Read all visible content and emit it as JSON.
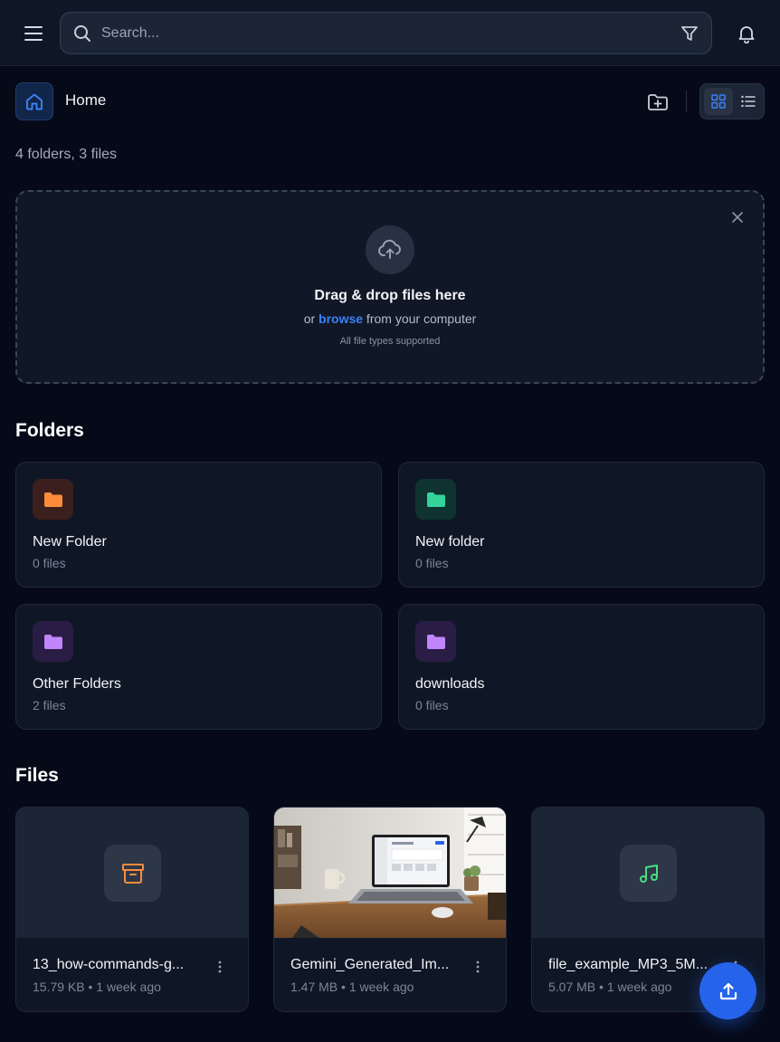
{
  "colors": {
    "background": "#060a18",
    "accent": "#2563eb",
    "link": "#3b82f6",
    "folder_orange": "#fb8c3c",
    "folder_green": "#34d399",
    "folder_purple": "#c084fc",
    "audio_green": "#4ade80"
  },
  "header": {
    "menu_icon": "menu-icon",
    "search_placeholder": "Search...",
    "filter_icon": "filter-icon",
    "notifications_icon": "bell-icon"
  },
  "toolbar": {
    "breadcrumb": "Home",
    "home_icon": "home-icon",
    "new_folder_icon": "folder-plus-icon",
    "view_modes": [
      "grid",
      "list"
    ],
    "active_view": "grid"
  },
  "summary": "4 folders, 3 files",
  "dropzone": {
    "title": "Drag & drop files here",
    "sub_prefix": "or ",
    "browse": "browse",
    "sub_suffix": " from your computer",
    "note": "All file types supported",
    "icon": "cloud-upload-icon"
  },
  "folders_title": "Folders",
  "folders": [
    {
      "name": "New Folder",
      "count": "0 files",
      "color": "orange"
    },
    {
      "name": "New folder",
      "count": "0 files",
      "color": "green"
    },
    {
      "name": "Other Folders",
      "count": "2 files",
      "color": "purple"
    },
    {
      "name": "downloads",
      "count": "0 files",
      "color": "purple"
    }
  ],
  "files_title": "Files",
  "files": [
    {
      "name": "13_how-commands-g...",
      "size": "15.79 KB",
      "age": "1 week ago",
      "kind": "archive"
    },
    {
      "name": "Gemini_Generated_Im...",
      "size": "1.47 MB",
      "age": "1 week ago",
      "kind": "image"
    },
    {
      "name": "file_example_MP3_5M...",
      "size": "5.07 MB",
      "age": "1 week ago",
      "kind": "audio"
    }
  ],
  "meta_separator": "•",
  "fab_icon": "upload-icon"
}
